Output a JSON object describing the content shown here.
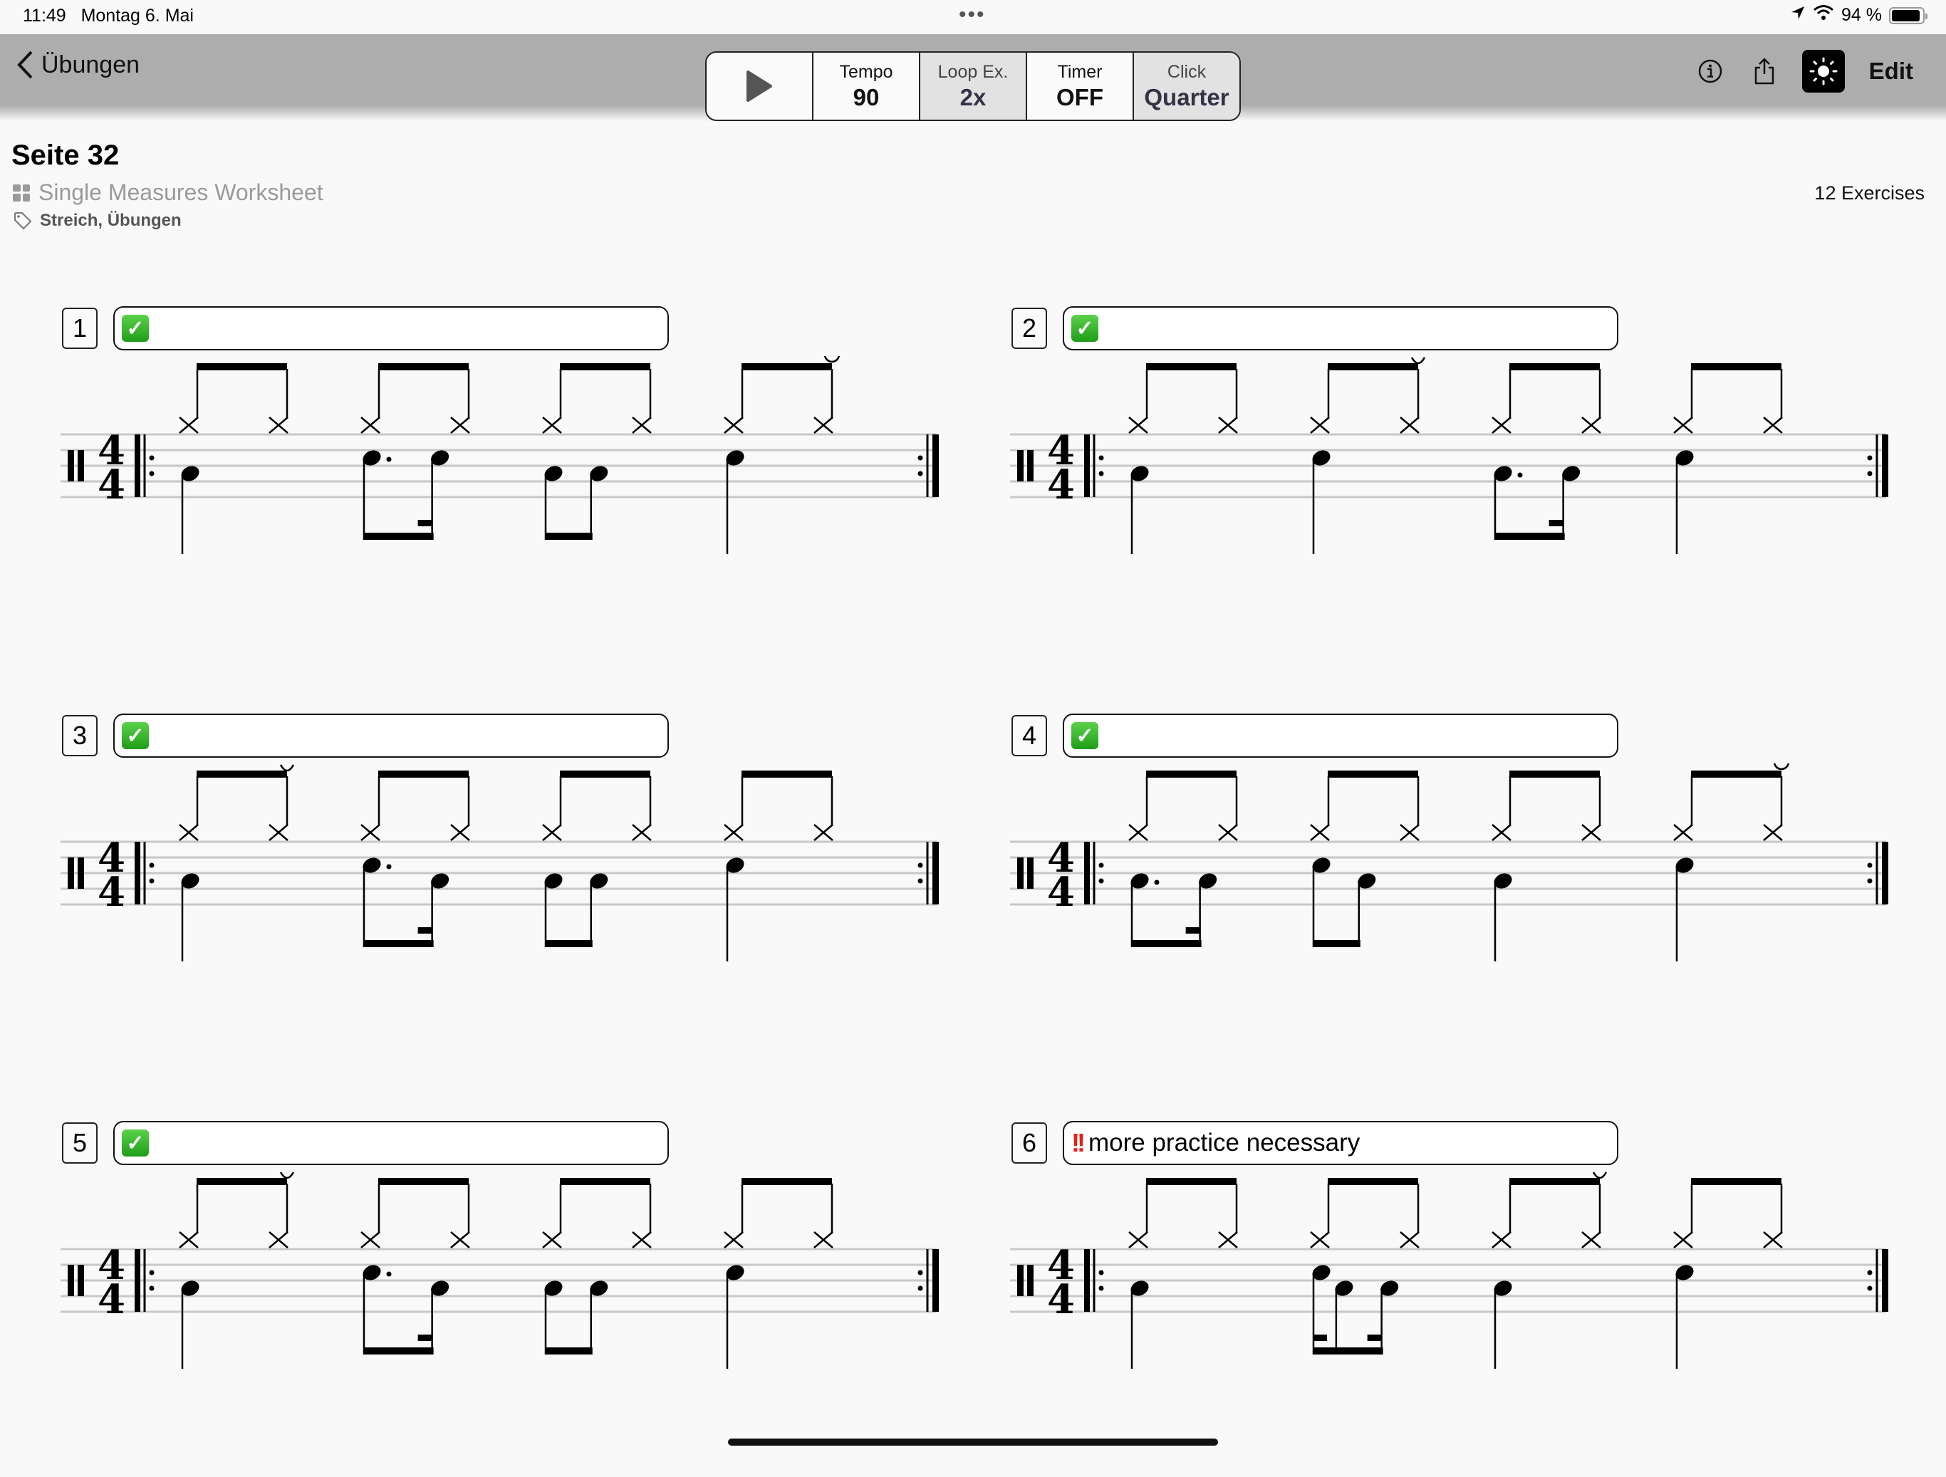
{
  "status_bar": {
    "time": "11:49",
    "date": "Montag 6. Mai",
    "battery": "94 %",
    "battery_level": 0.94
  },
  "nav": {
    "back_label": "Übungen",
    "transport": [
      {
        "label": "Tempo",
        "value": "90",
        "style": "white"
      },
      {
        "label": "Loop Ex.",
        "value": "2x",
        "style": "grey"
      },
      {
        "label": "Timer",
        "value": "OFF",
        "style": "white"
      },
      {
        "label": "Click",
        "value": "Quarter",
        "style": "grey"
      }
    ],
    "edit_label": "Edit",
    "icons": [
      "info-icon",
      "share-icon",
      "brightness-icon"
    ]
  },
  "page": {
    "title": "Seite 32",
    "worksheet": "Single Measures Worksheet",
    "tags": "Streich, Übungen",
    "exercise_count": "12 Exercises"
  },
  "exercises": [
    {
      "number": "1",
      "status": "check",
      "note": "",
      "hihat_open": [
        8
      ],
      "hihat_closed_mark": [],
      "groups": [
        {
          "beat": 1,
          "notes": [
            {
              "pos": 0,
              "inst": "bass"
            }
          ]
        },
        {
          "beat": 2,
          "notes": [
            {
              "pos": 0,
              "inst": "snare",
              "dot": true
            },
            {
              "pos": 0.75,
              "inst": "snare"
            }
          ],
          "beam": "8-16"
        },
        {
          "beat": 3,
          "notes": [
            {
              "pos": 0,
              "inst": "bass"
            },
            {
              "pos": 0.5,
              "inst": "bass"
            }
          ],
          "beam": "8-8"
        },
        {
          "beat": 4,
          "notes": [
            {
              "pos": 0,
              "inst": "snare"
            }
          ]
        }
      ]
    },
    {
      "number": "2",
      "status": "check",
      "note": "",
      "hihat_open": [],
      "hihat_closed_mark": [
        4
      ],
      "groups": [
        {
          "beat": 1,
          "notes": [
            {
              "pos": 0,
              "inst": "bass"
            }
          ]
        },
        {
          "beat": 2,
          "notes": [
            {
              "pos": 0,
              "inst": "snare"
            }
          ]
        },
        {
          "beat": 3,
          "notes": [
            {
              "pos": 0,
              "inst": "bass",
              "dot": true
            },
            {
              "pos": 0.75,
              "inst": "bass"
            }
          ],
          "beam": "8-16"
        },
        {
          "beat": 4,
          "notes": [
            {
              "pos": 0,
              "inst": "snare"
            }
          ]
        }
      ]
    },
    {
      "number": "3",
      "status": "check",
      "note": "",
      "hihat_open": [],
      "hihat_closed_mark": [
        2
      ],
      "groups": [
        {
          "beat": 1,
          "notes": [
            {
              "pos": 0,
              "inst": "bass"
            }
          ]
        },
        {
          "beat": 2,
          "notes": [
            {
              "pos": 0,
              "inst": "snare",
              "dot": true
            },
            {
              "pos": 0.75,
              "inst": "bass"
            }
          ],
          "beam": "8-16"
        },
        {
          "beat": 3,
          "notes": [
            {
              "pos": 0,
              "inst": "bass"
            },
            {
              "pos": 0.5,
              "inst": "bass"
            }
          ],
          "beam": "8-8"
        },
        {
          "beat": 4,
          "notes": [
            {
              "pos": 0,
              "inst": "snare"
            }
          ]
        }
      ]
    },
    {
      "number": "4",
      "status": "check",
      "note": "",
      "hihat_open": [
        8
      ],
      "hihat_closed_mark": [],
      "groups": [
        {
          "beat": 1,
          "notes": [
            {
              "pos": 0,
              "inst": "bass",
              "dot": true
            },
            {
              "pos": 0.75,
              "inst": "bass"
            }
          ],
          "beam": "8-16"
        },
        {
          "beat": 2,
          "notes": [
            {
              "pos": 0,
              "inst": "snare"
            },
            {
              "pos": 0.5,
              "inst": "bass"
            }
          ],
          "beam": "8-8"
        },
        {
          "beat": 3,
          "notes": [
            {
              "pos": 0,
              "inst": "bass"
            }
          ]
        },
        {
          "beat": 4,
          "notes": [
            {
              "pos": 0,
              "inst": "snare"
            }
          ]
        }
      ]
    },
    {
      "number": "5",
      "status": "check",
      "note": "",
      "hihat_open": [],
      "hihat_closed_mark": [
        2
      ],
      "groups": [
        {
          "beat": 1,
          "notes": [
            {
              "pos": 0,
              "inst": "bass"
            }
          ]
        },
        {
          "beat": 2,
          "notes": [
            {
              "pos": 0,
              "inst": "snare",
              "dot": true
            },
            {
              "pos": 0.75,
              "inst": "bass"
            }
          ],
          "beam": "8-16"
        },
        {
          "beat": 3,
          "notes": [
            {
              "pos": 0,
              "inst": "bass"
            },
            {
              "pos": 0.5,
              "inst": "bass"
            }
          ],
          "beam": "8-8"
        },
        {
          "beat": 4,
          "notes": [
            {
              "pos": 0,
              "inst": "snare"
            }
          ]
        }
      ]
    },
    {
      "number": "6",
      "status": "warning",
      "note": "more practice necessary",
      "hihat_open": [],
      "hihat_closed_mark": [
        6
      ],
      "groups": [
        {
          "beat": 1,
          "notes": [
            {
              "pos": 0,
              "inst": "bass"
            }
          ]
        },
        {
          "beat": 2,
          "notes": [
            {
              "pos": 0,
              "inst": "snare"
            },
            {
              "pos": 0.25,
              "inst": "bass"
            },
            {
              "pos": 0.75,
              "inst": "bass"
            }
          ],
          "beam": "16-8-16"
        },
        {
          "beat": 3,
          "notes": [
            {
              "pos": 0,
              "inst": "bass"
            }
          ]
        },
        {
          "beat": 4,
          "notes": [
            {
              "pos": 0,
              "inst": "snare"
            }
          ]
        }
      ]
    }
  ]
}
